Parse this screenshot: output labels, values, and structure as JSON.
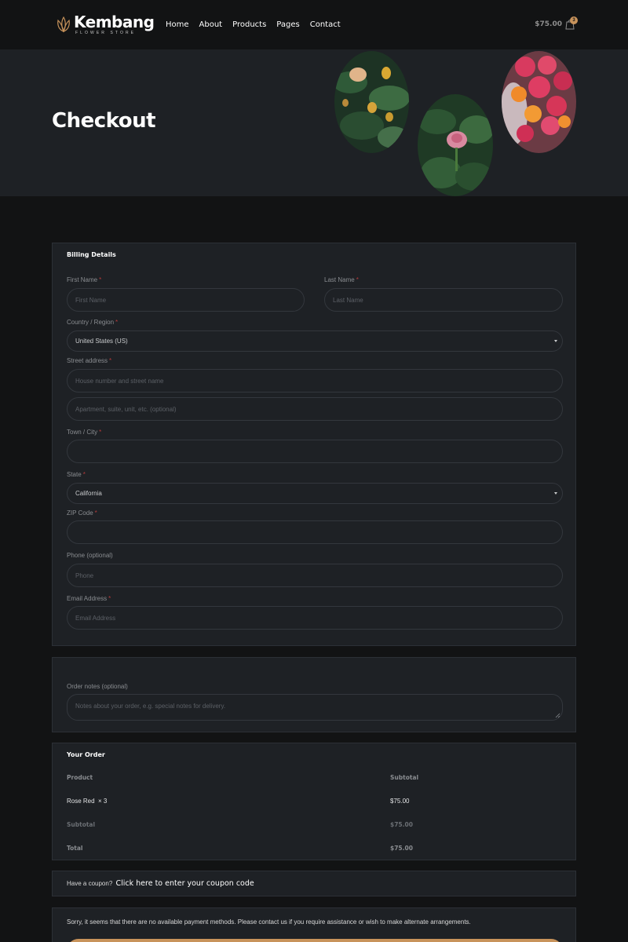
{
  "header": {
    "logo_title": "Kembang",
    "logo_subtitle": "FLOWER STORE",
    "nav": [
      "Home",
      "About",
      "Products",
      "Pages",
      "Contact"
    ],
    "cart_amount": "$75.00",
    "cart_count": "3",
    "accent_color": "#c8935b"
  },
  "hero": {
    "title": "Checkout",
    "images": [
      "rose-bush-photo",
      "pink-rose-photo",
      "bouquet-photo"
    ]
  },
  "billing": {
    "heading": "Billing Details",
    "first_name": {
      "label": "First Name",
      "placeholder": "First Name"
    },
    "last_name": {
      "label": "Last Name",
      "placeholder": "Last Name"
    },
    "country": {
      "label": "Country / Region",
      "value": "United States (US)"
    },
    "street": {
      "label": "Street address",
      "placeholder": "House number and street name",
      "placeholder2": "Apartment, suite, unit, etc. (optional)"
    },
    "city": {
      "label": "Town / City",
      "value": ""
    },
    "state": {
      "label": "State",
      "value": "California"
    },
    "zip": {
      "label": "ZIP Code",
      "value": ""
    },
    "phone": {
      "label": "Phone (optional)",
      "placeholder": "Phone"
    },
    "email": {
      "label": "Email Address",
      "placeholder": "Email Address"
    },
    "required_mark": "*"
  },
  "notes": {
    "label": "Order notes (optional)",
    "placeholder": "Notes about your order, e.g. special notes for delivery."
  },
  "order": {
    "heading": "Your Order",
    "col_product": "Product",
    "col_subtotal": "Subtotal",
    "item_name": "Rose Red",
    "item_qty": "× 3",
    "item_subtotal": "$75.00",
    "subtotal_label": "Subtotal",
    "subtotal_value": "$75.00",
    "total_label": "Total",
    "total_value": "$75.00"
  },
  "coupon": {
    "prompt": "Have a coupon?",
    "link": "Click here to enter your coupon code"
  },
  "payment": {
    "message": "Sorry, it seems that there are no available payment methods. Please contact us if you require assistance or wish to make alternate arrangements."
  }
}
